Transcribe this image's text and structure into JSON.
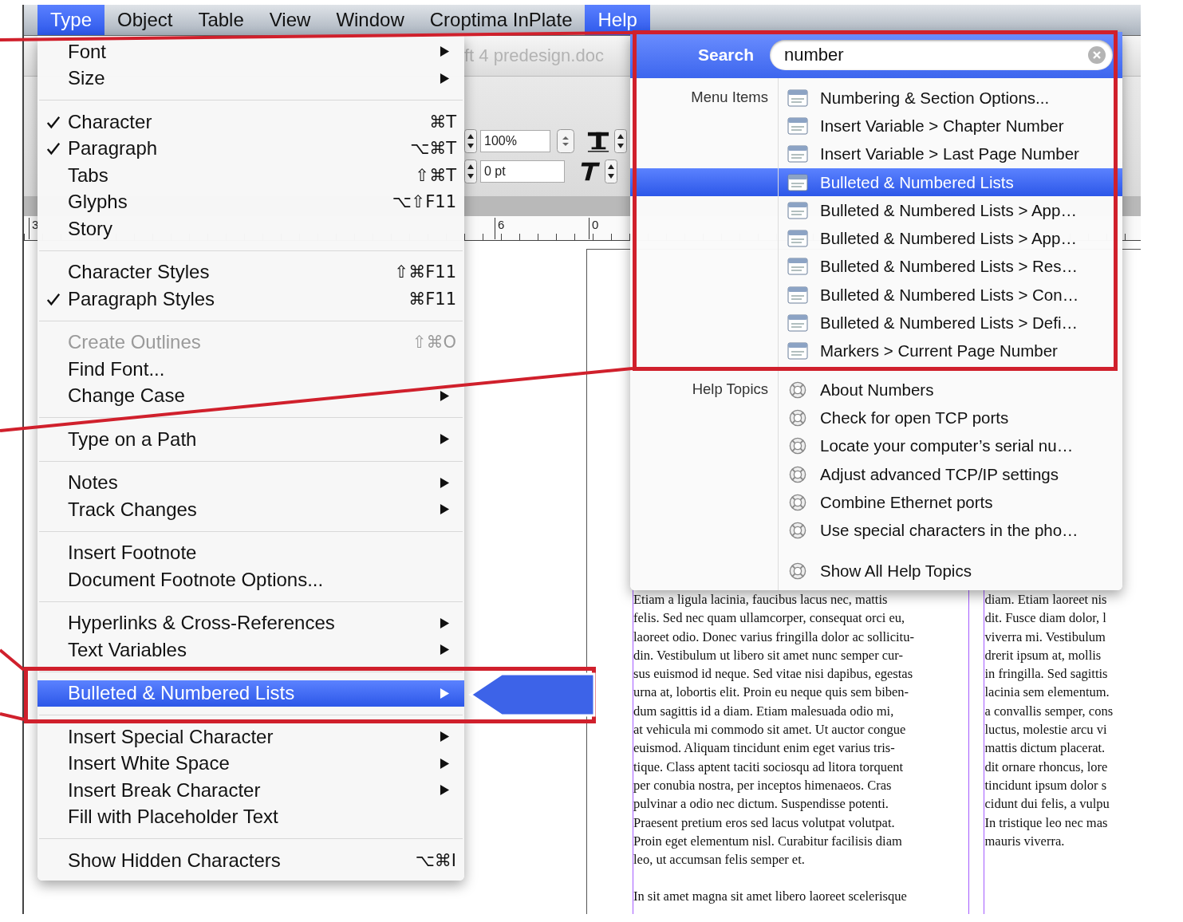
{
  "menu_bar": {
    "items": [
      {
        "label": "Type",
        "selected": true
      },
      {
        "label": "Object",
        "selected": false
      },
      {
        "label": "Table",
        "selected": false
      },
      {
        "label": "View",
        "selected": false
      },
      {
        "label": "Window",
        "selected": false
      },
      {
        "label": "Croptima InPlate",
        "selected": false
      },
      {
        "label": "Help",
        "selected": true
      }
    ]
  },
  "document_window": {
    "title": "ft 4 predesign.doc",
    "tracking_field": "100%",
    "baseline_field": "0 pt",
    "ruler_labels": [
      "3",
      "6",
      "0"
    ],
    "columns": [
      {
        "paragraphs": [
          [
            "Etiam a ligula lacinia, faucibus lacus nec, mattis",
            "felis. Sed nec quam ullamcorper, consequat orci eu,",
            "laoreet odio. Donec varius fringilla dolor ac sollicitu-",
            "din. Vestibulum ut libero sit amet nunc semper cur-",
            "sus euismod id neque. Sed vitae nisi dapibus, egestas",
            "urna at, lobortis elit. Proin eu neque quis sem biben-",
            "dum sagittis id a diam. Etiam malesuada odio mi,",
            "at vehicula mi commodo sit amet. Ut auctor congue",
            "euismod. Aliquam tincidunt enim eget varius tris-",
            "tique. Class aptent taciti sociosqu ad litora torquent",
            "per conubia nostra, per inceptos himenaeos. Cras",
            "pulvinar a odio nec dictum. Suspendisse potenti.",
            "Praesent pretium eros sed lacus volutpat volutpat.",
            "Proin eget elementum nisl. Curabitur facilisis diam",
            "leo, ut accumsan felis semper et."
          ],
          [
            "In sit amet magna sit amet libero laoreet scelerisque"
          ]
        ]
      },
      {
        "paragraphs": [
          [
            "diam. Etiam laoreet nis",
            "dit. Fusce diam dolor, l",
            "viverra mi. Vestibulum",
            "drerit ipsum at, mollis",
            "in fringilla. Sed sagittis",
            "lacinia sem elementum.",
            "a convallis semper, cons",
            "luctus, molestie arcu vi",
            "mattis dictum placerat.",
            "dit ornare rhoncus, lore",
            "tincidunt ipsum dolor s",
            "cidunt dui felis, a vulpu",
            "In tristique leo nec mas",
            "mauris viverra."
          ]
        ]
      }
    ]
  },
  "type_menu": {
    "items": [
      {
        "kind": "item",
        "label": "Font",
        "checked": false,
        "submenu": true,
        "disabled": false,
        "selected": false
      },
      {
        "kind": "item",
        "label": "Size",
        "checked": false,
        "submenu": true,
        "disabled": false,
        "selected": false
      },
      {
        "kind": "separator"
      },
      {
        "kind": "item",
        "label": "Character",
        "shortcut": "⌘T",
        "checked": true,
        "submenu": false,
        "disabled": false,
        "selected": false
      },
      {
        "kind": "item",
        "label": "Paragraph",
        "shortcut": "⌥⌘T",
        "checked": true,
        "submenu": false,
        "disabled": false,
        "selected": false
      },
      {
        "kind": "item",
        "label": "Tabs",
        "shortcut": "⇧⌘T",
        "checked": false,
        "submenu": false,
        "disabled": false,
        "selected": false
      },
      {
        "kind": "item",
        "label": "Glyphs",
        "shortcut": "⌥⇧F11",
        "checked": false,
        "submenu": false,
        "disabled": false,
        "selected": false
      },
      {
        "kind": "item",
        "label": "Story",
        "checked": false,
        "submenu": false,
        "disabled": false,
        "selected": false
      },
      {
        "kind": "separator"
      },
      {
        "kind": "item",
        "label": "Character Styles",
        "shortcut": "⇧⌘F11",
        "checked": false,
        "submenu": false,
        "disabled": false,
        "selected": false
      },
      {
        "kind": "item",
        "label": "Paragraph Styles",
        "shortcut": "⌘F11",
        "checked": true,
        "submenu": false,
        "disabled": false,
        "selected": false
      },
      {
        "kind": "separator"
      },
      {
        "kind": "item",
        "label": "Create Outlines",
        "shortcut": "⇧⌘O",
        "checked": false,
        "submenu": false,
        "disabled": true,
        "selected": false
      },
      {
        "kind": "item",
        "label": "Find Font...",
        "checked": false,
        "submenu": false,
        "disabled": false,
        "selected": false
      },
      {
        "kind": "item",
        "label": "Change Case",
        "checked": false,
        "submenu": true,
        "disabled": false,
        "selected": false
      },
      {
        "kind": "separator"
      },
      {
        "kind": "item",
        "label": "Type on a Path",
        "checked": false,
        "submenu": true,
        "disabled": false,
        "selected": false
      },
      {
        "kind": "separator"
      },
      {
        "kind": "item",
        "label": "Notes",
        "checked": false,
        "submenu": true,
        "disabled": false,
        "selected": false
      },
      {
        "kind": "item",
        "label": "Track Changes",
        "checked": false,
        "submenu": true,
        "disabled": false,
        "selected": false
      },
      {
        "kind": "separator"
      },
      {
        "kind": "item",
        "label": "Insert Footnote",
        "checked": false,
        "submenu": false,
        "disabled": false,
        "selected": false
      },
      {
        "kind": "item",
        "label": "Document Footnote Options...",
        "checked": false,
        "submenu": false,
        "disabled": false,
        "selected": false
      },
      {
        "kind": "separator"
      },
      {
        "kind": "item",
        "label": "Hyperlinks & Cross-References",
        "checked": false,
        "submenu": true,
        "disabled": false,
        "selected": false
      },
      {
        "kind": "item",
        "label": "Text Variables",
        "checked": false,
        "submenu": true,
        "disabled": false,
        "selected": false
      },
      {
        "kind": "separator"
      },
      {
        "kind": "item",
        "label": "Bulleted & Numbered Lists",
        "checked": false,
        "submenu": true,
        "disabled": false,
        "selected": true
      },
      {
        "kind": "separator"
      },
      {
        "kind": "item",
        "label": "Insert Special Character",
        "checked": false,
        "submenu": true,
        "disabled": false,
        "selected": false
      },
      {
        "kind": "item",
        "label": "Insert White Space",
        "checked": false,
        "submenu": true,
        "disabled": false,
        "selected": false
      },
      {
        "kind": "item",
        "label": "Insert Break Character",
        "checked": false,
        "submenu": true,
        "disabled": false,
        "selected": false
      },
      {
        "kind": "item",
        "label": "Fill with Placeholder Text",
        "checked": false,
        "submenu": false,
        "disabled": false,
        "selected": false
      },
      {
        "kind": "separator"
      },
      {
        "kind": "item",
        "label": "Show Hidden Characters",
        "shortcut": "⌥⌘I",
        "checked": false,
        "submenu": false,
        "disabled": false,
        "selected": false
      }
    ]
  },
  "help_menu": {
    "search_label": "Search",
    "search_value": "number",
    "sections": [
      {
        "label": "Menu Items",
        "kind": "menu",
        "items": [
          {
            "label": "Numbering & Section Options...",
            "selected": false
          },
          {
            "label": "Insert Variable > Chapter Number",
            "selected": false
          },
          {
            "label": "Insert Variable > Last Page Number",
            "selected": false
          },
          {
            "label": "Bulleted & Numbered Lists",
            "selected": true
          },
          {
            "label": "Bulleted & Numbered Lists > App…",
            "selected": false
          },
          {
            "label": "Bulleted & Numbered Lists > App…",
            "selected": false
          },
          {
            "label": "Bulleted & Numbered Lists > Res…",
            "selected": false
          },
          {
            "label": "Bulleted & Numbered Lists > Con…",
            "selected": false
          },
          {
            "label": "Bulleted & Numbered Lists > Defi…",
            "selected": false
          },
          {
            "label": "Markers > Current Page Number",
            "selected": false
          }
        ]
      },
      {
        "label": "Help Topics",
        "kind": "help",
        "items": [
          {
            "label": "About Numbers",
            "selected": false
          },
          {
            "label": "Check for open TCP ports",
            "selected": false
          },
          {
            "label": "Locate your computer’s serial nu…",
            "selected": false
          },
          {
            "label": "Adjust advanced TCP/IP settings",
            "selected": false
          },
          {
            "label": "Combine Ethernet ports",
            "selected": false
          },
          {
            "label": "Use special characters in the pho…",
            "selected": false
          }
        ]
      },
      {
        "kind": "help",
        "items": [
          {
            "label": "Show All Help Topics",
            "selected": false
          }
        ]
      }
    ]
  }
}
